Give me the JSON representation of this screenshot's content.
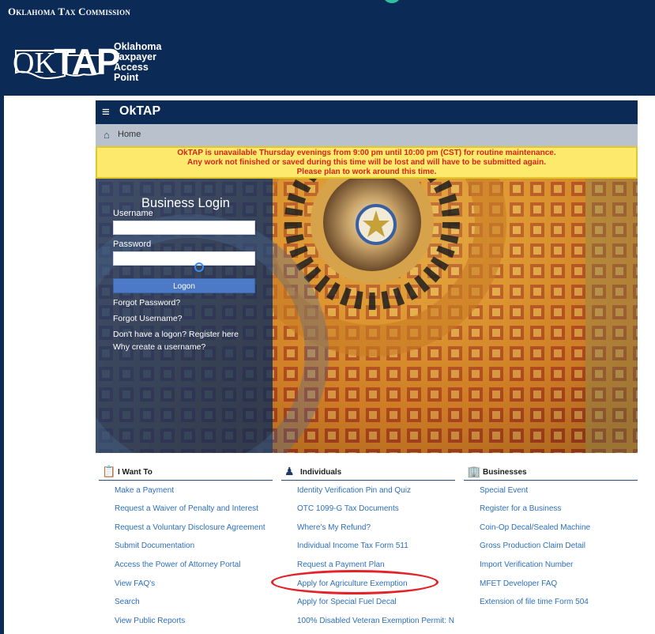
{
  "header": {
    "agency": "Oklahoma Tax Commission",
    "logo_ok": "OK",
    "logo_tap": "TAP",
    "logo_tagline": [
      "Oklahoma",
      "Taxpayer",
      "Access",
      "Point"
    ]
  },
  "topbar": {
    "menu_icon": "hamburger-icon",
    "title": "OkTAP"
  },
  "breadcrumb": {
    "icon": "home-icon",
    "label": "Home"
  },
  "notice": [
    "OkTAP is unavailable Thursday evenings from 9:00 pm until 10:00 pm (CST) for routine maintenance.",
    "Any work not finished or saved during this time will be lost and will have to be submitted again.",
    "Please plan to work around this time."
  ],
  "login": {
    "title": "Business Login",
    "username_label": "Username",
    "username_value": "",
    "password_label": "Password",
    "password_value": "",
    "logon_label": "Logon",
    "forgot_password": "Forgot Password?",
    "forgot_username": "Forgot Username?",
    "register": "Don't have a logon? Register here",
    "why_create": "Why create a username?"
  },
  "sections": {
    "iwant": {
      "icon": "clipboard-icon",
      "title": "I Want To",
      "items": [
        "Make a Payment",
        "Request a Waiver of Penalty and Interest",
        "Request a Voluntary Disclosure Agreement",
        "Submit Documentation",
        "Access the Power of Attorney Portal",
        "View FAQ's",
        "Search",
        "View Public Reports"
      ]
    },
    "individuals": {
      "icon": "person-icon",
      "title": "Individuals",
      "items": [
        "Identity Verification Pin and Quiz",
        "OTC 1099-G Tax Documents",
        "Where's My Refund?",
        "Individual Income Tax Form 511",
        "Request a Payment Plan",
        "Apply for Agriculture Exemption",
        "Apply for Special Fuel Decal",
        "100% Disabled Veteran Exemption Permit: N"
      ]
    },
    "businesses": {
      "icon": "building-icon",
      "title": "Businesses",
      "items": [
        "Special Event",
        "Register for a Business",
        "Coin-Op Decal/Sealed Machine",
        "Gross Production Claim Detail",
        "Import Verification Number",
        "MFET Developer FAQ",
        "Extension of file time Form 504"
      ]
    }
  },
  "colors": {
    "navy": "#0b2a55",
    "link": "#2d6fb8",
    "notice_bg": "#fde96c",
    "notice_text": "#d3261c",
    "logon": "#4d7ac6",
    "annotation_ring": "#e3222a"
  }
}
